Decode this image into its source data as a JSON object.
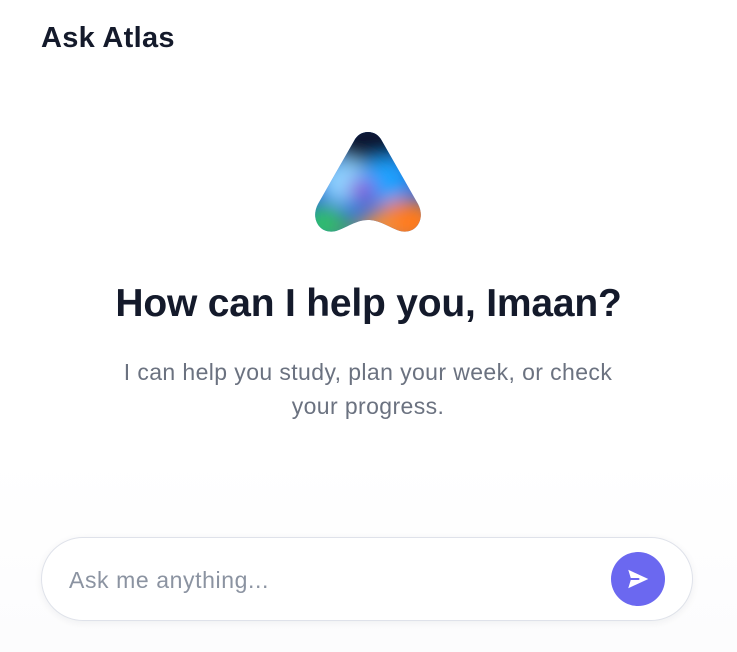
{
  "header": {
    "title": "Ask Atlas"
  },
  "logo": {
    "icon": "atlas-logo-icon",
    "colors": {
      "dark": "#0b1330",
      "blue": "#2ea8ff",
      "orange": "#ff7a1e",
      "green": "#2fbf6b",
      "purple": "#7a4dd8"
    }
  },
  "welcome": {
    "headline": "How can I help you, Imaan?",
    "subtext": "I can help you study, plan your week, or check your progress."
  },
  "composer": {
    "placeholder": "Ask me anything...",
    "value": "",
    "send_icon": "send-icon",
    "accent_color": "#6b68f0"
  }
}
